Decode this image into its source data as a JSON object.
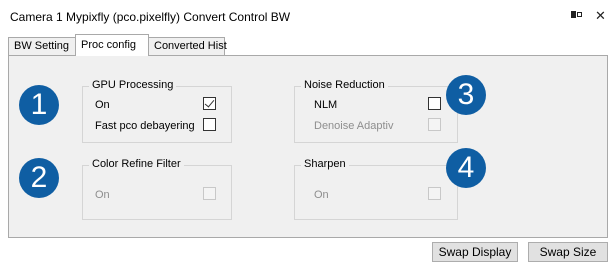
{
  "window": {
    "title": "Camera 1 Mypixfly (pco.pixelfly) Convert Control BW"
  },
  "tabs": [
    {
      "label": "BW Setting"
    },
    {
      "label": "Proc config"
    },
    {
      "label": "Converted Hist"
    }
  ],
  "gpu_processing": {
    "title": "GPU Processing",
    "on_label": "On",
    "on_checked": true,
    "debayer_label": "Fast pco debayering",
    "debayer_checked": false
  },
  "noise_reduction": {
    "title": "Noise Reduction",
    "nlm_label": "NLM",
    "nlm_checked": false,
    "denoise_label": "Denoise Adaptiv",
    "denoise_checked": false
  },
  "color_refine": {
    "title": "Color Refine Filter",
    "on_label": "On",
    "on_checked": false
  },
  "sharpen": {
    "title": "Sharpen",
    "on_label": "On",
    "on_checked": false
  },
  "badges": [
    "1",
    "2",
    "3",
    "4"
  ],
  "buttons": {
    "swap_display": "Swap Display",
    "swap_size": "Swap Size"
  }
}
